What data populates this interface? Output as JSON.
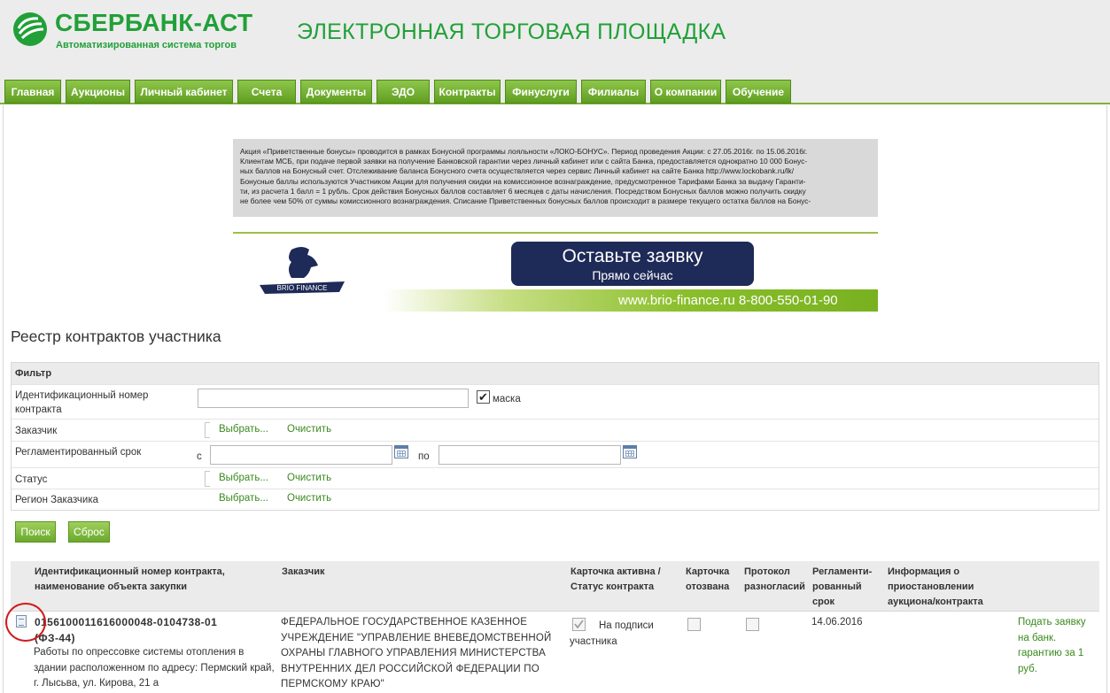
{
  "brand": {
    "name": "СБЕРБАНК-АСТ",
    "subtitle": "Автоматизированная система торгов",
    "site_title": "ЭЛЕКТРОННАЯ ТОРГОВАЯ ПЛОЩАДКА",
    "brand_color": "#21a038"
  },
  "nav": {
    "items": [
      "Главная",
      "Аукционы",
      "Личный кабинет",
      "Счета",
      "Документы",
      "ЭДО",
      "Контракты",
      "Финуслуги",
      "Филиалы",
      "О компании",
      "Обучение"
    ]
  },
  "promo": {
    "lines": [
      "Акция «Приветственные бонусы» проводится в рамках Бонусной программы лояльности «ЛОКО-БОНУС». Период проведения Акции: с 27.05.2016г. по 15.06.2016г.",
      "Клиентам МСБ, при подаче первой заявки на получение Банковской гарантии через личный кабинет или с сайта Банка, предоставляется однократно 10 000 Бонус-",
      "ных баллов на Бонусный счет. Отслеживание баланса Бонусного счета осуществляется через сервис Личный кабинет на сайте Банка http://www.lockobank.ru/lk/",
      "Бонусные баллы используются Участником Акции для получения скидки на комиссионное вознаграждение, предусмотренное Тарифами Банка за выдачу Гаранти-",
      "ти, из расчета 1 балл = 1 рубль. Срок действия Бонусных баллов составляет 6 месяцев с даты начисления. Посредством Бонусных баллов можно получить скидку",
      "не более чем 50% от суммы комиссионного вознаграждения. Списание Приветственных бонусных баллов происходит в размере текущего остатка баллов на Бонус-"
    ]
  },
  "banner": {
    "logo_text": "BRIO FINANCE",
    "cta_line1": "Оставьте заявку",
    "cta_line2": "Прямо сейчас",
    "site_phone": "www.brio-finance.ru  8-800-550-01-90"
  },
  "page": {
    "title": "Реестр контрактов участника"
  },
  "filter": {
    "heading": "Фильтр",
    "id_label": "Идентификационный номер контракта",
    "id_value": "",
    "mask_label": "маска",
    "mask_checked": true,
    "customer_label": "Заказчик",
    "deadline_label": "Регламентированный срок",
    "from_label": "с",
    "to_label": "по",
    "status_label": "Статус",
    "region_label": "Регион Заказчика",
    "choose_label": "Выбрать...",
    "clear_label": "Очистить",
    "search_button": "Поиск",
    "reset_button": "Сброс"
  },
  "table": {
    "headers": [
      "Идентификационный номер контракта, наименование объекта закупки",
      "Заказчик",
      "Карточка активна / Статус контракта",
      "Карточка отозвана",
      "Протокол разногласий",
      "Регламенти-рованный срок",
      "Информация о приостановлении аукциона/контракта"
    ],
    "rows": [
      {
        "contract_number": "0156100011616000048-0104738-01",
        "law": "(ФЗ-44)",
        "object": "Работы по опрессовке системы отопления в здании расположенном по адресу: Пермский край, г. Лысьва, ул. Кирова, 21 а",
        "customer": "ФЕДЕРАЛЬНОЕ ГОСУДАРСТВЕННОЕ КАЗЕННОЕ УЧРЕЖДЕНИЕ \"УПРАВЛЕНИЕ ВНЕВЕДОМСТВЕННОЙ ОХРАНЫ ГЛАВНОГО УПРАВЛЕНИЯ МИНИСТЕРСТВА ВНУТРЕННИХ ДЕЛ РОССИЙСКОЙ ФЕДЕРАЦИИ ПО ПЕРМСКОМУ КРАЮ\"",
        "card_active": true,
        "status": "На подписи участника",
        "card_revoked": false,
        "protocol": false,
        "deadline": "14.06.2016",
        "suspension_info": "",
        "action": "Подать заявку на банк. гарантию за 1 руб."
      }
    ]
  },
  "accent_color": "#7fb23a",
  "link_color": "#3a8a1e"
}
